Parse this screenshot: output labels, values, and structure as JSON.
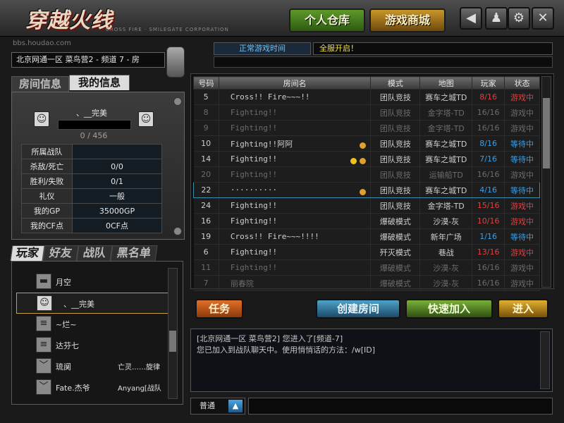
{
  "banner": {
    "logo": "穿越火线",
    "logo_sub": "CROSS FIRE · SMILEGATE CORPORATION",
    "site": "bbs.houdao.com",
    "warehouse": "个人仓库",
    "mall": "游戏商城",
    "sys_buttons": [
      {
        "name": "back-icon",
        "glyph": "◀"
      },
      {
        "name": "profile-icon",
        "glyph": "♟"
      },
      {
        "name": "settings-icon",
        "glyph": "⚙"
      },
      {
        "name": "close-icon",
        "glyph": "✕"
      }
    ]
  },
  "location": "北京网通一区 菜鸟营2 - 频道 7 - 房",
  "notice": {
    "label": "正常游戏时间",
    "text": "全服开启！"
  },
  "tabs": {
    "room_info": "房间信息",
    "my_info": "我的信息"
  },
  "profile": {
    "name": "、__完美",
    "exp": "0 / 456"
  },
  "stats": [
    {
      "key": "所属战队",
      "value": ""
    },
    {
      "key": "杀敌/死亡",
      "value": "0/0"
    },
    {
      "key": "胜利/失败",
      "value": "0/1"
    },
    {
      "key": "礼仪",
      "value": "一般"
    },
    {
      "key": "我的GP",
      "value": "35000GP"
    },
    {
      "key": "我的CF点",
      "value": "0CF点"
    }
  ],
  "friend_tabs": [
    "玩家",
    "好友",
    "战队",
    "黑名单"
  ],
  "friends": [
    {
      "name": "月空",
      "extra": ""
    },
    {
      "name": "、__完美",
      "extra": ""
    },
    {
      "name": "~烂~",
      "extra": ""
    },
    {
      "name": "达芬七",
      "extra": ""
    },
    {
      "name": "琉阒",
      "extra": "亡灵……旋律"
    },
    {
      "name": "Fate.杰爷",
      "extra": "Anyang[战队"
    }
  ],
  "room_table": {
    "headers": [
      "号码",
      "房间名",
      "模式",
      "地图",
      "玩家",
      "状态"
    ],
    "rows": [
      {
        "no": "5",
        "name": "Cross!! Fire~~~!!",
        "mode": "团队竞技",
        "map": "赛车之城TD",
        "players": "8/16",
        "state": "游戏中",
        "dim": false,
        "pcolor": "red",
        "scolor": "red",
        "lock": false,
        "tag": false
      },
      {
        "no": "8",
        "name": "Fighting!!",
        "mode": "团队竞技",
        "map": "金字塔-TD",
        "players": "16/16",
        "state": "游戏中",
        "dim": true,
        "pcolor": "",
        "scolor": "",
        "lock": false,
        "tag": false
      },
      {
        "no": "9",
        "name": "Fighting!!",
        "mode": "团队竞技",
        "map": "金字塔-TD",
        "players": "16/16",
        "state": "游戏中",
        "dim": true,
        "pcolor": "",
        "scolor": "",
        "lock": false,
        "tag": false
      },
      {
        "no": "10",
        "name": "Fighting!!阿阿",
        "mode": "团队竞技",
        "map": "赛车之城TD",
        "players": "8/16",
        "state": "等待中",
        "dim": false,
        "pcolor": "blue",
        "scolor": "blue",
        "lock": true,
        "tag": false
      },
      {
        "no": "14",
        "name": "Fighting!!",
        "mode": "团队竞技",
        "map": "赛车之城TD",
        "players": "7/16",
        "state": "等待中",
        "dim": false,
        "pcolor": "blue",
        "scolor": "blue",
        "lock": true,
        "tag": true
      },
      {
        "no": "20",
        "name": "Fighting!!",
        "mode": "团队竞技",
        "map": "运输船TD",
        "players": "16/16",
        "state": "游戏中",
        "dim": true,
        "pcolor": "",
        "scolor": "",
        "lock": false,
        "tag": false
      },
      {
        "no": "22",
        "name": "··········",
        "mode": "团队竞技",
        "map": "赛车之城TD",
        "players": "4/16",
        "state": "等待中",
        "dim": false,
        "pcolor": "blue",
        "scolor": "blue",
        "lock": true,
        "tag": false,
        "hl": true
      },
      {
        "no": "24",
        "name": "Fighting!!",
        "mode": "团队竞技",
        "map": "金字塔-TD",
        "players": "15/16",
        "state": "游戏中",
        "dim": false,
        "pcolor": "red",
        "scolor": "red",
        "lock": false,
        "tag": false
      },
      {
        "no": "16",
        "name": "Fighting!!",
        "mode": "爆破模式",
        "map": "沙漠-灰",
        "players": "10/16",
        "state": "游戏中",
        "dim": false,
        "pcolor": "red",
        "scolor": "red",
        "lock": false,
        "tag": false
      },
      {
        "no": "19",
        "name": "Cross!! Fire~~~!!!!",
        "mode": "爆破模式",
        "map": "新年广场",
        "players": "1/16",
        "state": "等待中",
        "dim": false,
        "pcolor": "blue",
        "scolor": "blue",
        "lock": false,
        "tag": false
      },
      {
        "no": "6",
        "name": "Fighting!!",
        "mode": "歼灭模式",
        "map": "巷战",
        "players": "13/16",
        "state": "游戏中",
        "dim": false,
        "pcolor": "red",
        "scolor": "red",
        "lock": false,
        "tag": false
      },
      {
        "no": "11",
        "name": "Fighting!!",
        "mode": "爆破模式",
        "map": "沙漠-灰",
        "players": "16/16",
        "state": "游戏中",
        "dim": true,
        "pcolor": "",
        "scolor": "",
        "lock": false,
        "tag": false
      },
      {
        "no": "7",
        "name": "丽春院",
        "mode": "爆破模式",
        "map": "沙漠-灰",
        "players": "16/16",
        "state": "游戏中",
        "dim": true,
        "pcolor": "",
        "scolor": "",
        "lock": false,
        "tag": false
      }
    ]
  },
  "actions": {
    "task": "任务",
    "create": "创建房间",
    "quick": "快速加入",
    "enter": "进入"
  },
  "chat": {
    "lines": [
      "[北京网通一区 菜鸟营2] 您进入了[频道-7]",
      "您已加入到战队聊天中。使用悄悄话的方法：/w[ID]"
    ],
    "mode": "普通",
    "mode_btn": "▲"
  },
  "colors": {
    "state_red": "#e04040",
    "state_blue": "#3aa0e8",
    "notice": "#f0e040"
  }
}
